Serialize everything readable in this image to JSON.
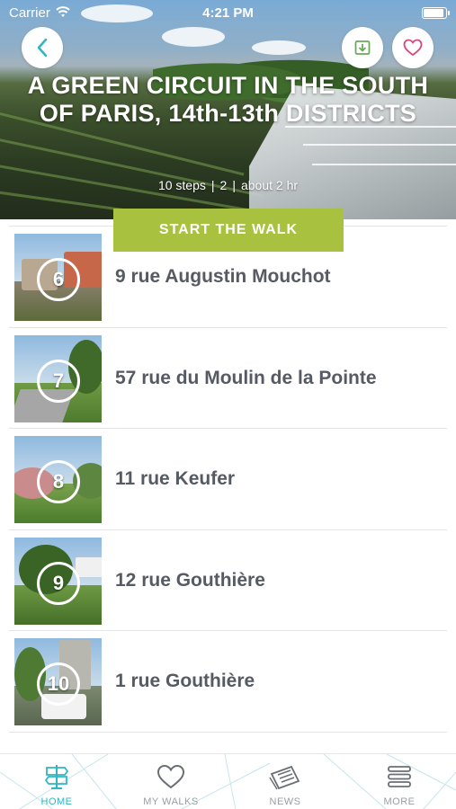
{
  "status_bar": {
    "carrier": "Carrier",
    "time": "4:21 PM",
    "battery_level": 0.95
  },
  "hero": {
    "title": "A GREEN CIRCUIT IN THE SOUTH OF PARIS, 14th-13th DISTRICTS",
    "steps": "10 steps",
    "difficulty": "2",
    "duration": "about 2 hr",
    "separator": "|"
  },
  "actions": {
    "start_label": "START THE WALK"
  },
  "icons": {
    "back": "chevron-left-icon",
    "download": "download-icon",
    "favorite": "heart-icon"
  },
  "colors": {
    "accent_green": "#a8c13e",
    "accent_teal": "#2fb6c4",
    "heart_pink": "#d8457a",
    "download_green": "#6aaa5a"
  },
  "steps": [
    {
      "number": "6",
      "name": "9 rue Augustin Mouchot"
    },
    {
      "number": "7",
      "name": "57 rue du Moulin de la Pointe"
    },
    {
      "number": "8",
      "name": "11 rue Keufer"
    },
    {
      "number": "9",
      "name": "12 rue Gouthière"
    },
    {
      "number": "10",
      "name": "1 rue Gouthière"
    }
  ],
  "tabs": [
    {
      "label": "HOME",
      "icon": "signpost-icon",
      "active": true
    },
    {
      "label": "MY WALKS",
      "icon": "heart-icon",
      "active": false
    },
    {
      "label": "NEWS",
      "icon": "newspaper-icon",
      "active": false
    },
    {
      "label": "MORE",
      "icon": "menu-icon",
      "active": false
    }
  ]
}
